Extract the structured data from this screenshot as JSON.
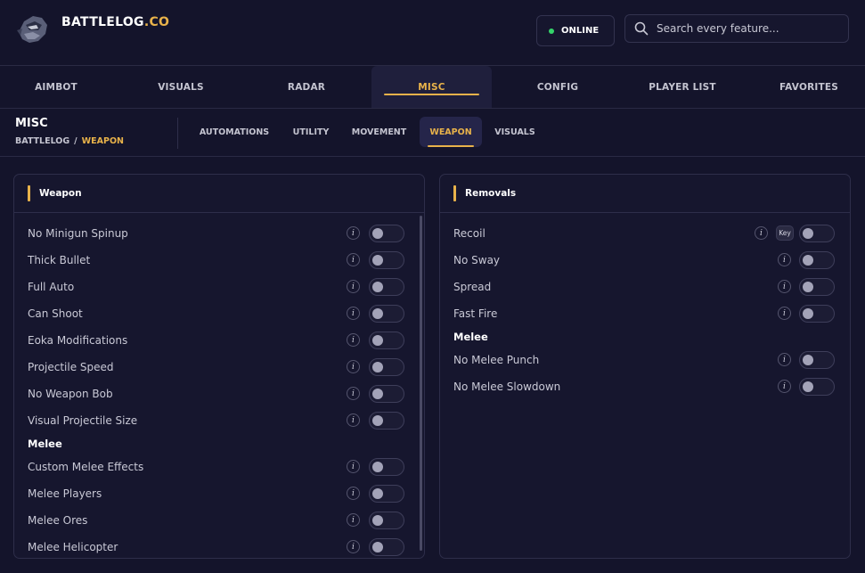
{
  "header": {
    "brand_main": "BATTLELOG",
    "brand_suffix": ".CO",
    "status": "ONLINE",
    "search_placeholder": "Search every feature..."
  },
  "main_tabs": [
    {
      "label": "AIMBOT",
      "active": false
    },
    {
      "label": "VISUALS",
      "active": false
    },
    {
      "label": "RADAR",
      "active": false
    },
    {
      "label": "MISC",
      "active": true
    },
    {
      "label": "CONFIG",
      "active": false
    },
    {
      "label": "PLAYER LIST",
      "active": false
    },
    {
      "label": "FAVORITES",
      "active": false
    }
  ],
  "section": {
    "title": "MISC",
    "breadcrumb_root": "BATTLELOG",
    "breadcrumb_sep": "/",
    "breadcrumb_current": "WEAPON"
  },
  "sub_tabs": [
    {
      "label": "AUTOMATIONS",
      "active": false
    },
    {
      "label": "UTILITY",
      "active": false
    },
    {
      "label": "MOVEMENT",
      "active": false
    },
    {
      "label": "WEAPON",
      "active": true
    },
    {
      "label": "VISUALS",
      "active": false
    }
  ],
  "weapon_panel": {
    "title": "Weapon",
    "items": [
      {
        "label": "No Minigun Spinup",
        "enabled": false
      },
      {
        "label": "Thick Bullet",
        "enabled": false
      },
      {
        "label": "Full Auto",
        "enabled": false
      },
      {
        "label": "Can Shoot",
        "enabled": false
      },
      {
        "label": "Eoka Modifications",
        "enabled": false
      },
      {
        "label": "Projectile Speed",
        "enabled": false
      },
      {
        "label": "No Weapon Bob",
        "enabled": false
      },
      {
        "label": "Visual Projectile Size",
        "enabled": false
      }
    ],
    "group_label": "Melee",
    "group_items": [
      {
        "label": "Custom Melee Effects",
        "enabled": false
      },
      {
        "label": "Melee Players",
        "enabled": false
      },
      {
        "label": "Melee Ores",
        "enabled": false
      },
      {
        "label": "Melee Helicopter",
        "enabled": false
      }
    ]
  },
  "removals_panel": {
    "title": "Removals",
    "items": [
      {
        "label": "Recoil",
        "enabled": false,
        "key": "Key"
      },
      {
        "label": "No Sway",
        "enabled": false
      },
      {
        "label": "Spread",
        "enabled": false
      },
      {
        "label": "Fast Fire",
        "enabled": false
      }
    ],
    "group_label": "Melee",
    "group_items": [
      {
        "label": "No Melee Punch",
        "enabled": false
      },
      {
        "label": "No Melee Slowdown",
        "enabled": false
      }
    ]
  },
  "info_glyph": "i",
  "colors": {
    "accent": "#e8b24a",
    "background": "#14142b",
    "panel": "#16162e",
    "online": "#34d36a"
  }
}
